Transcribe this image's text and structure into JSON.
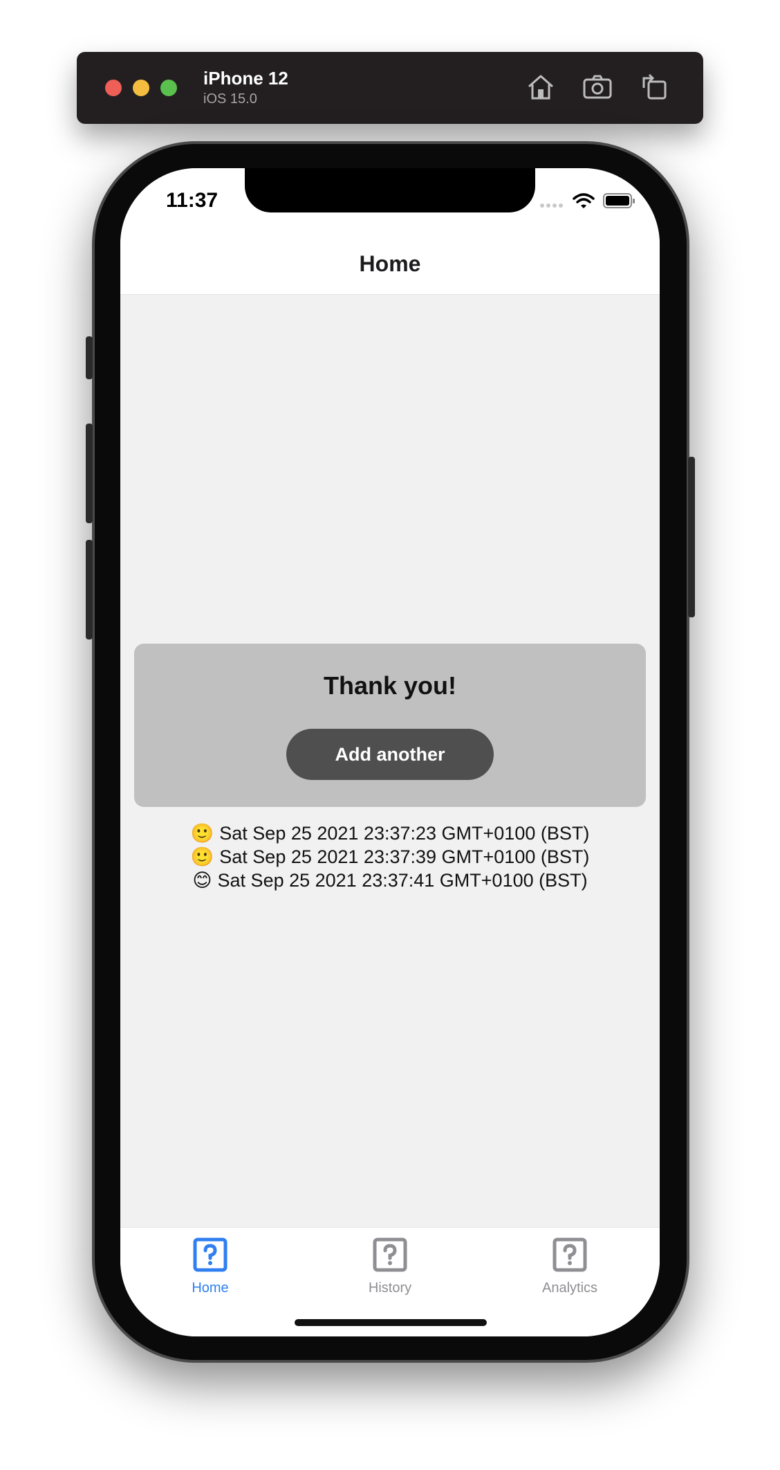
{
  "simulator": {
    "device_name": "iPhone 12",
    "os_version": "iOS 15.0",
    "buttons": [
      "home-icon",
      "screenshot-icon",
      "rotate-icon"
    ]
  },
  "status_bar": {
    "time": "11:37",
    "icons": [
      "cellular-icon",
      "wifi-icon",
      "battery-icon"
    ]
  },
  "header": {
    "title": "Home"
  },
  "card": {
    "title": "Thank you!",
    "button_label": "Add another"
  },
  "entries": [
    {
      "emoji": "🙂",
      "text": "Sat Sep 25 2021 23:37:23 GMT+0100 (BST)"
    },
    {
      "emoji": "🙂",
      "text": "Sat Sep 25 2021 23:37:39 GMT+0100 (BST)"
    },
    {
      "emoji": "😊",
      "text": "Sat Sep 25 2021 23:37:41 GMT+0100 (BST)"
    }
  ],
  "tabs": [
    {
      "label": "Home",
      "icon": "question-icon",
      "active": true
    },
    {
      "label": "History",
      "icon": "question-icon",
      "active": false
    },
    {
      "label": "Analytics",
      "icon": "question-icon",
      "active": false
    }
  ],
  "colors": {
    "accent": "#2f7ff1",
    "inactive": "#8e8e93",
    "card_bg": "#c0c0c0",
    "button_bg": "#4f4f4f",
    "screen_bg": "#f1f1f1"
  }
}
